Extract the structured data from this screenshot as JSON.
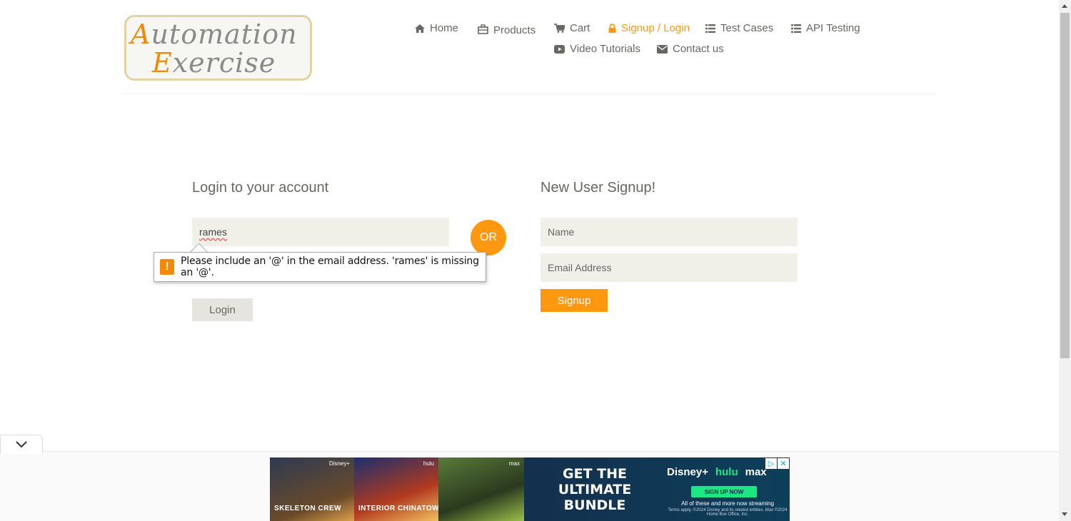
{
  "logo": {
    "line1_cap": "A",
    "line1_rest": "utomation",
    "line2_cap": "E",
    "line2_rest": "xercise"
  },
  "nav": [
    {
      "label": "Home",
      "icon": "home-icon"
    },
    {
      "label": "Products",
      "icon": "products-icon"
    },
    {
      "label": "Cart",
      "icon": "cart-icon"
    },
    {
      "label": "Signup / Login",
      "icon": "lock-icon",
      "active": true
    },
    {
      "label": "Test Cases",
      "icon": "list-icon"
    },
    {
      "label": "API Testing",
      "icon": "list-icon"
    },
    {
      "label": "Video Tutorials",
      "icon": "youtube-icon"
    },
    {
      "label": "Contact us",
      "icon": "envelope-icon"
    }
  ],
  "login": {
    "title": "Login to your account",
    "email_value": "rames",
    "button": "Login"
  },
  "or_label": "OR",
  "signup": {
    "title": "New User Signup!",
    "name_placeholder": "Name",
    "email_placeholder": "Email Address",
    "button": "Signup"
  },
  "validation": {
    "icon_glyph": "!",
    "message": "Please include an '@' in the email address. 'rames' is missing an '@'."
  },
  "ad": {
    "posters": [
      {
        "title": "SKELETON CREW",
        "brand": "Disney+"
      },
      {
        "title": "INTERIOR CHINATOWN",
        "brand": "hulu"
      },
      {
        "title": "",
        "brand": "max"
      }
    ],
    "headline": "GET THE ULTIMATE BUNDLE",
    "brands": [
      "Disney+",
      "hulu",
      "max"
    ],
    "cta": "SIGN UP NOW",
    "fine_print": "All of these and more now streaming",
    "legal": "Terms apply. ©2024 Disney and its related entities. Max ©2024 Home Box Office, Inc.",
    "choices_glyph": "▷",
    "close_glyph": "✕"
  },
  "colors": {
    "accent": "#FE980F",
    "field_bg": "#F0F0E9",
    "text": "#696763"
  }
}
